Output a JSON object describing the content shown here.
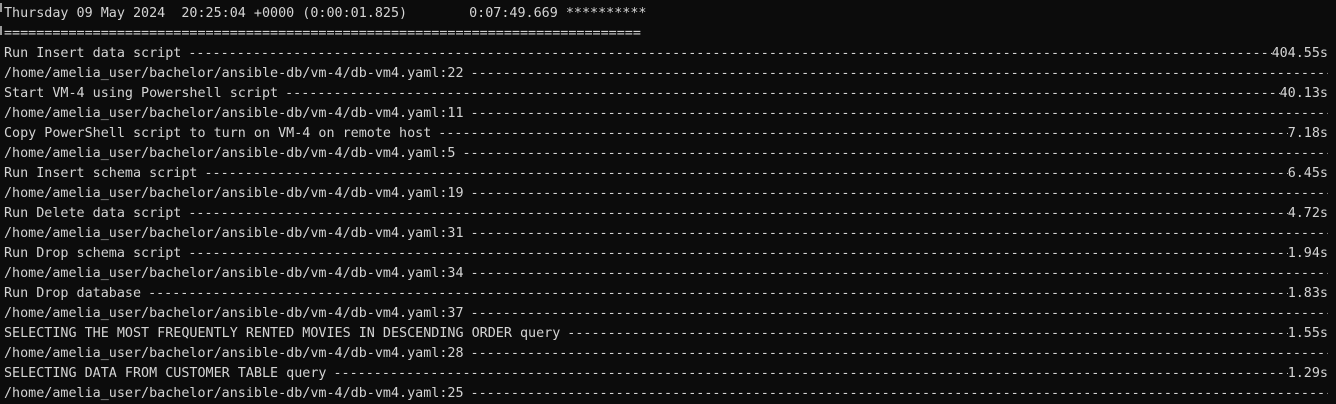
{
  "header": {
    "timestamp": "Thursday 09 May 2024  20:25:04 +0000 (0:00:01.825)",
    "elapsed": "0:07:49.669 **********",
    "separator": "==============================================================================="
  },
  "tasks": [
    {
      "name": "Run Insert data script",
      "duration": "404.55s",
      "path": "/home/amelia_user/bachelor/ansible-db/vm-4/db-vm4.yaml:22"
    },
    {
      "name": "Start VM-4 using Powershell script",
      "duration": "40.13s",
      "path": "/home/amelia_user/bachelor/ansible-db/vm-4/db-vm4.yaml:11"
    },
    {
      "name": "Copy PowerShell script to turn on VM-4 on remote host",
      "duration": "7.18s",
      "path": "/home/amelia_user/bachelor/ansible-db/vm-4/db-vm4.yaml:5"
    },
    {
      "name": "Run Insert schema script",
      "duration": "6.45s",
      "path": "/home/amelia_user/bachelor/ansible-db/vm-4/db-vm4.yaml:19"
    },
    {
      "name": "Run Delete data script",
      "duration": "4.72s",
      "path": "/home/amelia_user/bachelor/ansible-db/vm-4/db-vm4.yaml:31"
    },
    {
      "name": "Run Drop schema script",
      "duration": "1.94s",
      "path": "/home/amelia_user/bachelor/ansible-db/vm-4/db-vm4.yaml:34"
    },
    {
      "name": "Run Drop database",
      "duration": "1.83s",
      "path": "/home/amelia_user/bachelor/ansible-db/vm-4/db-vm4.yaml:37"
    },
    {
      "name": "SELECTING THE MOST FREQUENTLY RENTED MOVIES IN DESCENDING ORDER query",
      "duration": "1.55s",
      "path": "/home/amelia_user/bachelor/ansible-db/vm-4/db-vm4.yaml:28"
    },
    {
      "name": "SELECTING DATA FROM CUSTOMER TABLE query",
      "duration": "1.29s",
      "path": "/home/amelia_user/bachelor/ansible-db/vm-4/db-vm4.yaml:25"
    }
  ]
}
